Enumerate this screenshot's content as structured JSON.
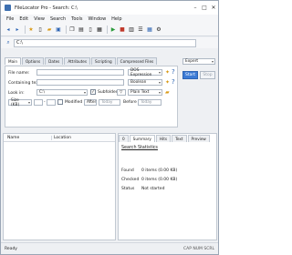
{
  "window": {
    "title": "FileLocator Pro - Search: C:\\"
  },
  "window_controls": [
    "–",
    "□",
    "✕"
  ],
  "menu": [
    "File",
    "Edit",
    "View",
    "Search",
    "Tools",
    "Window",
    "Help"
  ],
  "path": {
    "value": "C:\\"
  },
  "criteria_tabs": [
    "Main",
    "Options",
    "Dates",
    "Attributes",
    "Scripting",
    "Compressed Files"
  ],
  "form": {
    "file_name_label": "File name:",
    "file_name_value": "",
    "file_name_mode": "DOS Expression",
    "containing_text_label": "Containing text:",
    "containing_text_value": "",
    "containing_text_mode": "Boolean",
    "look_in_label": "Look in:",
    "look_in_value": "C:\\",
    "subfolders_label": "Subfolders",
    "plain_text": "Plain Text",
    "size_label": "Size (KB)",
    "modified_label": "Modified",
    "after_label": "After",
    "before_label": "Before",
    "today_1": "Today",
    "today_2": "Today"
  },
  "expert": {
    "label": "Expert",
    "start": "Start",
    "stop": "Stop"
  },
  "results": {
    "col_name": "Name",
    "col_location": "Location"
  },
  "stats_tabs": [
    "0",
    "Summary",
    "Hits",
    "Text",
    "Preview"
  ],
  "stats": {
    "heading": "Search Statistics",
    "found_label": "Found",
    "found_value": "0 items (0.00 KB)",
    "checked_label": "Checked",
    "checked_value": "0 items (0.00 KB)",
    "status_label": "Status",
    "status_value": "Not started"
  },
  "statusbar": {
    "left": "Ready",
    "right": "CAP  NUM  SCRL"
  },
  "colors": {
    "accent": "#3c7bd6",
    "window_bg": "#eef0f3"
  }
}
